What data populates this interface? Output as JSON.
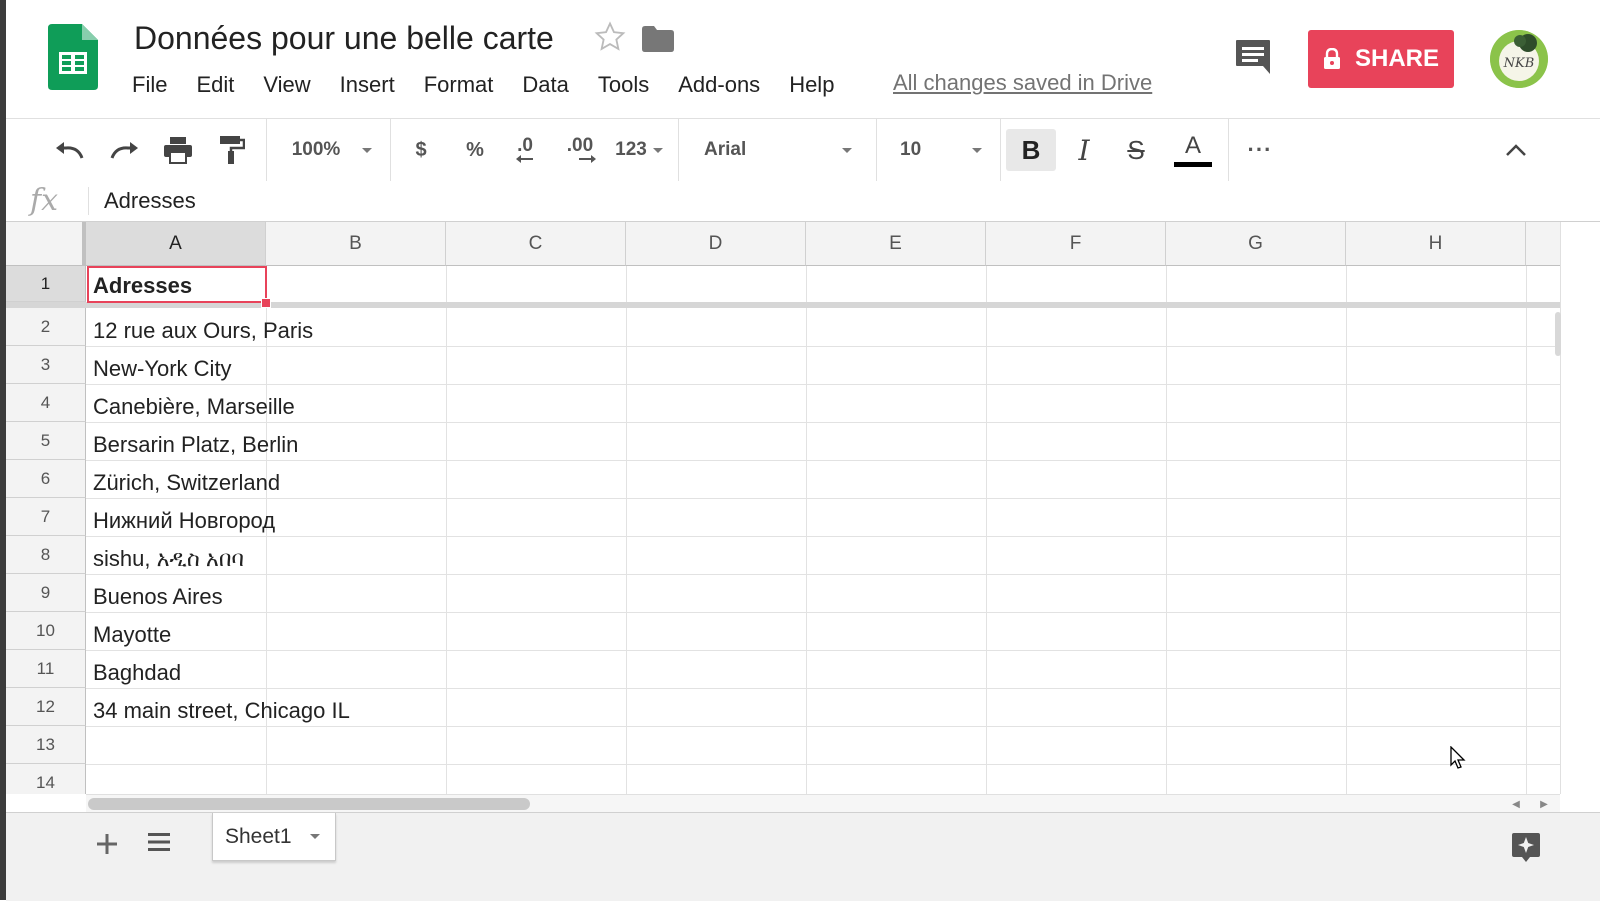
{
  "app": {
    "doc_title": "Données pour une belle carte",
    "saved_status": "All changes saved in Drive",
    "share_label": "SHARE",
    "brand_color": "#e8435a",
    "sheets_green": "#0f9d58",
    "avatar_text": "NKB"
  },
  "menu": {
    "items": [
      "File",
      "Edit",
      "View",
      "Insert",
      "Format",
      "Data",
      "Tools",
      "Add-ons",
      "Help"
    ]
  },
  "toolbar": {
    "zoom": "100%",
    "currency": "$",
    "percent": "%",
    "decrease_decimal": ".0",
    "increase_decimal": ".00",
    "more_formats": "123",
    "font": "Arial",
    "font_size": "10",
    "bold": "B",
    "italic": "I",
    "strikethrough": "S",
    "text_color": "A",
    "more": "···",
    "icons": [
      "undo-icon",
      "redo-icon",
      "print-icon",
      "paint-format-icon",
      "collapse-icon"
    ]
  },
  "formula_bar": {
    "fx": "fx",
    "value": "Adresses"
  },
  "sheet": {
    "columns": [
      "A",
      "B",
      "C",
      "D",
      "E",
      "F",
      "G",
      "H"
    ],
    "rows": [
      "1",
      "2",
      "3",
      "4",
      "5",
      "6",
      "7",
      "8",
      "9",
      "10",
      "11",
      "12",
      "13",
      "14"
    ],
    "selected_cell": "A1",
    "cells_col_a": [
      "Adresses",
      "12 rue aux Ours, Paris",
      "New-York City",
      "Canebière, Marseille",
      "Bersarin Platz, Berlin",
      "Zürich, Switzerland",
      "Нижний Новгород",
      "sishu,  አዲስ አበባ",
      "Buenos Aires",
      "Mayotte",
      "Baghdad",
      "34 main street, Chicago IL",
      "",
      ""
    ]
  },
  "tabs": {
    "sheets": [
      "Sheet1"
    ]
  }
}
